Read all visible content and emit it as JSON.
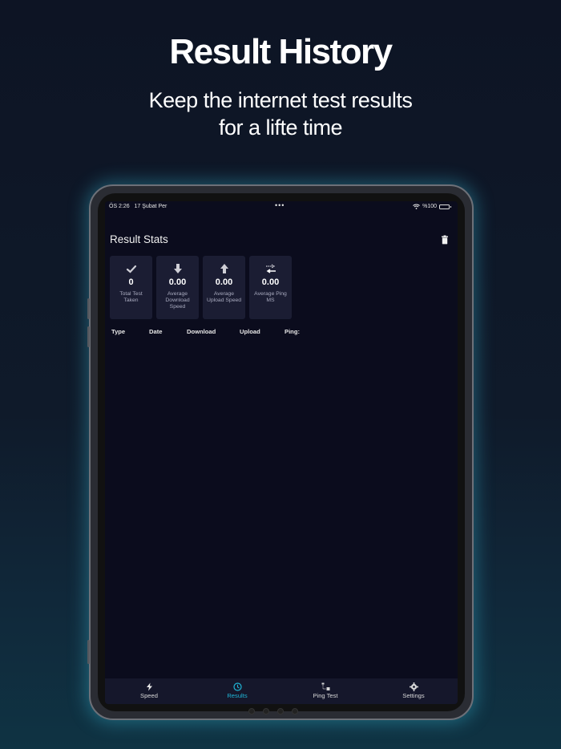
{
  "promo": {
    "title": "Result History",
    "subtitle_line1": "Keep the internet test results",
    "subtitle_line2": "for a lifte time"
  },
  "statusbar": {
    "time": "ÖS 2:26",
    "date": "17 Şubat Per",
    "dots": "•••",
    "battery_text": "%100"
  },
  "page": {
    "title": "Result Stats"
  },
  "stats": [
    {
      "icon": "checkmark-icon",
      "value": "0",
      "label": "Total Test Taken"
    },
    {
      "icon": "download-arrow-icon",
      "value": "0.00",
      "label": "Average Download Speed"
    },
    {
      "icon": "upload-arrow-icon",
      "value": "0.00",
      "label": "Average Upload Speed"
    },
    {
      "icon": "ping-arrows-icon",
      "value": "0.00",
      "label": "Average Ping MS"
    }
  ],
  "table": {
    "columns": [
      "Type",
      "Date",
      "Download",
      "Upload",
      "Ping:"
    ]
  },
  "tabbar": {
    "tabs": [
      {
        "label": "Speed",
        "icon": "bolt-icon",
        "active": false
      },
      {
        "label": "Results",
        "icon": "clock-icon",
        "active": true
      },
      {
        "label": "Ping Test",
        "icon": "ping-test-icon",
        "active": false
      },
      {
        "label": "Settings",
        "icon": "gear-icon",
        "active": false
      }
    ]
  },
  "colors": {
    "accent": "#1fb5d6",
    "screen_bg": "#0b0c1d",
    "card_bg": "#1b1d33"
  }
}
